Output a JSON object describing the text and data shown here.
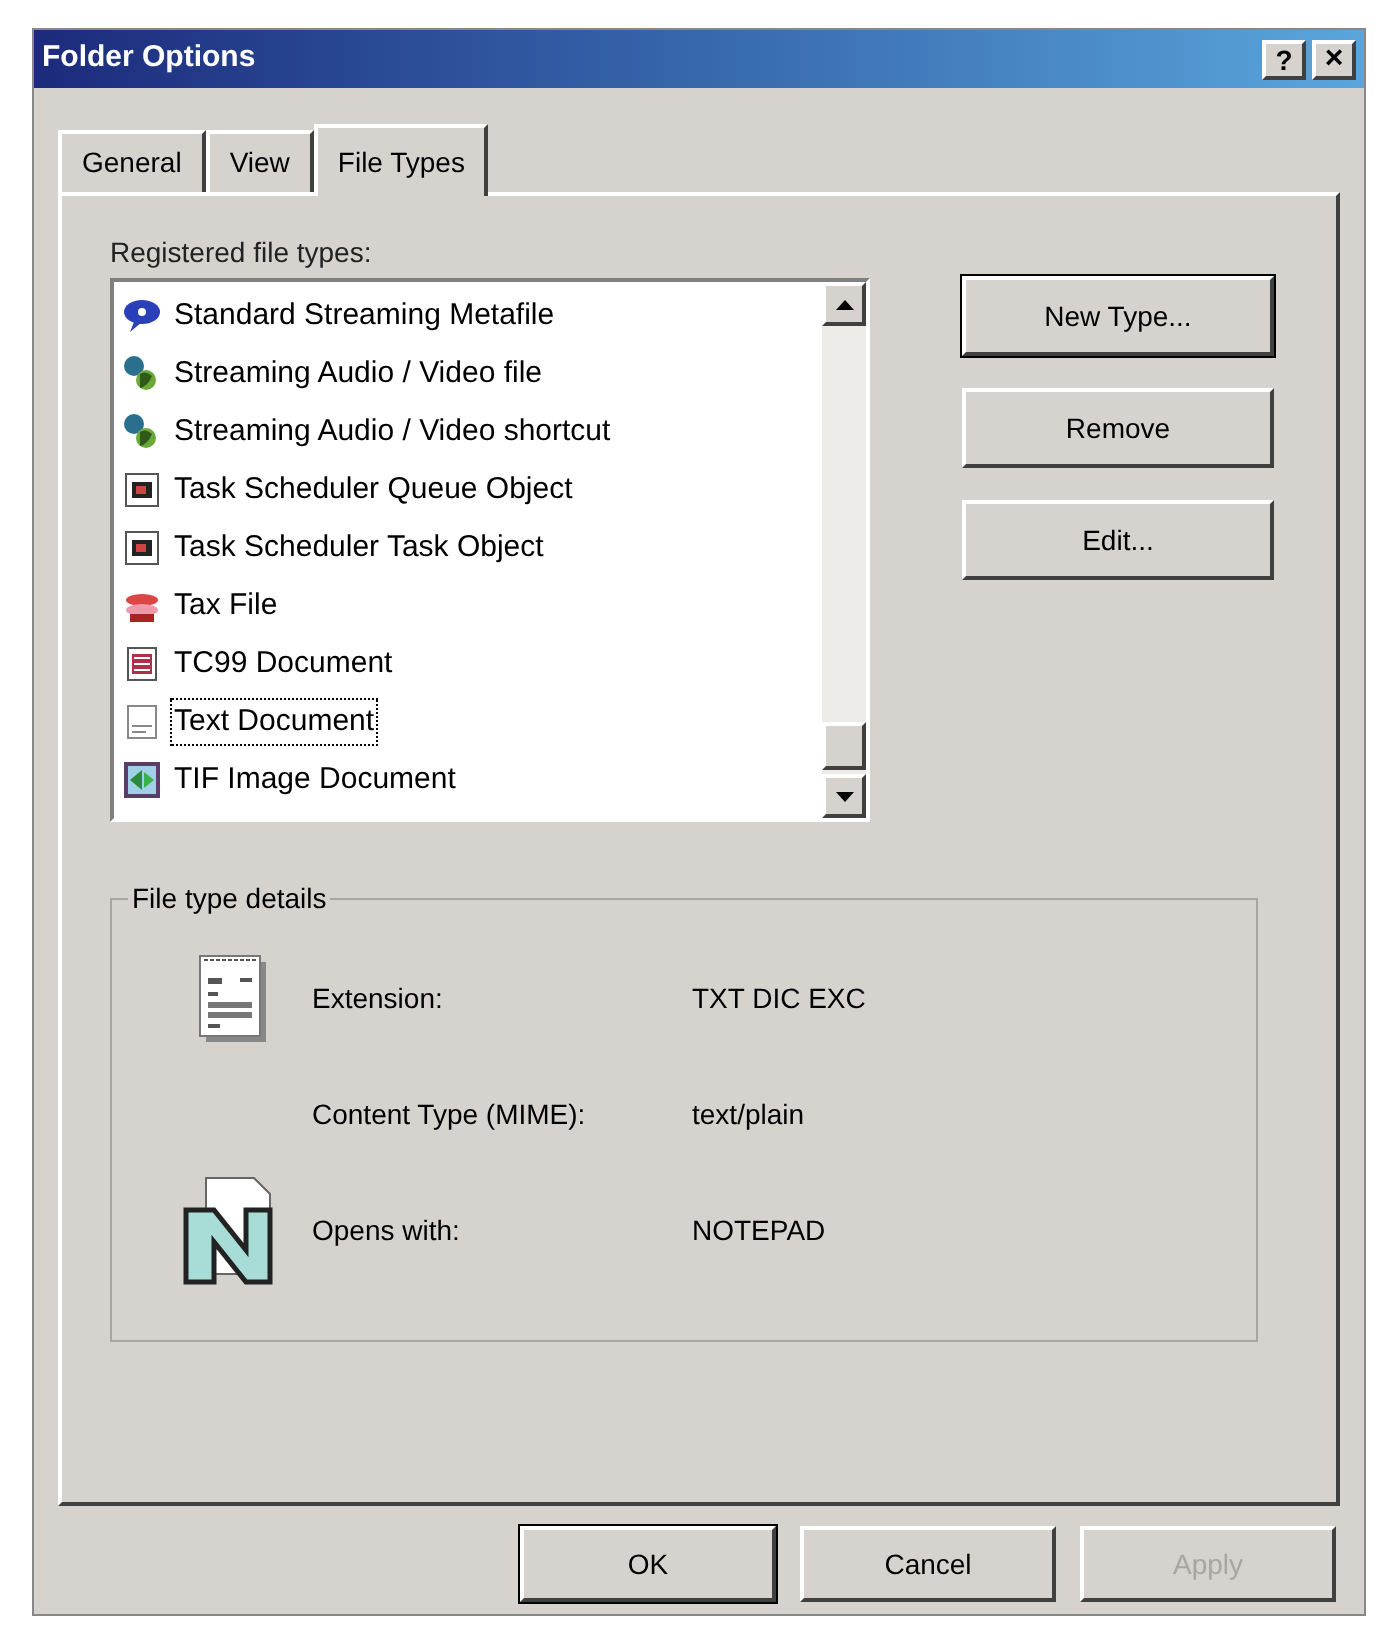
{
  "window": {
    "title": "Folder Options",
    "help_button": "?",
    "close_button": "×"
  },
  "tabs": [
    {
      "label": "General",
      "selected": false
    },
    {
      "label": "View",
      "selected": false
    },
    {
      "label": "File Types",
      "selected": true
    }
  ],
  "file_types": {
    "label": "Registered file types:",
    "items": [
      {
        "name": "Standard Streaming Metafile",
        "selected": false
      },
      {
        "name": "Streaming Audio / Video file",
        "selected": false
      },
      {
        "name": "Streaming Audio / Video shortcut",
        "selected": false
      },
      {
        "name": "Task Scheduler Queue Object",
        "selected": false
      },
      {
        "name": "Task Scheduler Task Object",
        "selected": false
      },
      {
        "name": "Tax File",
        "selected": false
      },
      {
        "name": "TC99 Document",
        "selected": false
      },
      {
        "name": "Text Document",
        "selected": true
      },
      {
        "name": "TIF Image Document",
        "selected": false
      }
    ]
  },
  "side_buttons": [
    {
      "label": "New Type...",
      "default": true
    },
    {
      "label": "Remove",
      "default": false
    },
    {
      "label": "Edit...",
      "default": false
    }
  ],
  "details": {
    "title": "File type details",
    "rows": [
      {
        "label": "Extension:",
        "value": "TXT DIC EXC"
      },
      {
        "label": "Content Type (MIME):",
        "value": "text/plain"
      },
      {
        "label": "Opens with:",
        "value": "NOTEPAD"
      }
    ]
  },
  "buttons": [
    {
      "label": "OK",
      "default": true,
      "disabled": false
    },
    {
      "label": "Cancel",
      "default": false,
      "disabled": false
    },
    {
      "label": "Apply",
      "default": false,
      "disabled": true
    }
  ]
}
